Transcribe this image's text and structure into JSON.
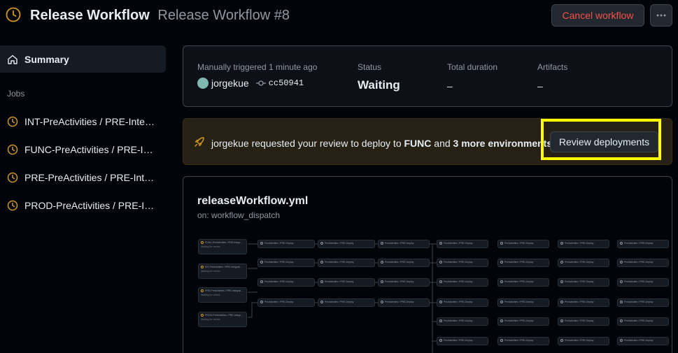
{
  "header": {
    "workflow_name": "Release Workflow",
    "run_title": "Release Workflow #8",
    "cancel_label": "Cancel workflow",
    "more_label": "…"
  },
  "sidebar": {
    "summary_label": "Summary",
    "jobs_heading": "Jobs",
    "jobs": [
      {
        "label": "INT-PreActivities / PRE-Integration"
      },
      {
        "label": "FUNC-PreActivities / PRE-Integration"
      },
      {
        "label": "PRE-PreActivities / PRE-Integration"
      },
      {
        "label": "PROD-PreActivities / PRE-Integration"
      }
    ]
  },
  "summary": {
    "trigger_text": "Manually triggered 1 minute ago",
    "actor": "jorgekue",
    "commit": "cc50941",
    "status_label": "Status",
    "status_value": "Waiting",
    "duration_label": "Total duration",
    "duration_value": "–",
    "artifacts_label": "Artifacts",
    "artifacts_value": "–"
  },
  "review": {
    "actor": "jorgekue",
    "text_before": " requested your review to deploy to ",
    "env": "FUNC",
    "text_and": " and ",
    "more_envs": "3 more environments",
    "button_label": "Review deployments"
  },
  "workflow": {
    "file": "releaseWorkflow.yml",
    "trigger": "on: workflow_dispatch",
    "first_jobs": [
      {
        "label": "FUNC-PreActivities / PRE-Integr...",
        "sub": "Waiting for review"
      },
      {
        "label": "INT-PreActivities / PRE-Integrati...",
        "sub": "Waiting for review"
      },
      {
        "label": "PRE-PreActivities / PRE-Integrat...",
        "sub": "Waiting for review"
      },
      {
        "label": "PROD-PreActivities / PRE-Integr...",
        "sub": "Waiting for review"
      }
    ],
    "stage_label": "PreActivities / PRE-Deploy",
    "colors": {
      "waiting": "#d29922",
      "danger": "#f85149",
      "highlight": "#ffff00"
    }
  }
}
